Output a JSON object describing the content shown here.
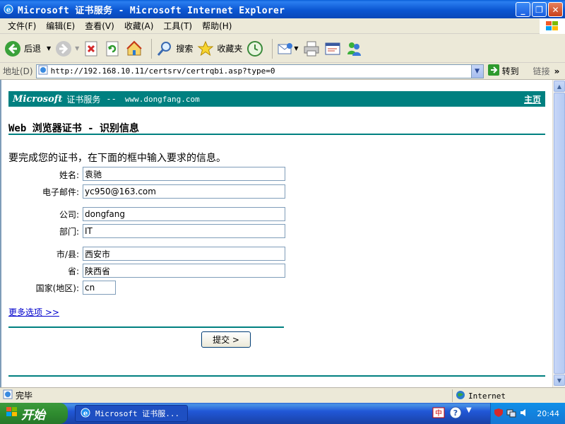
{
  "window": {
    "title": "Microsoft 证书服务 - Microsoft Internet Explorer"
  },
  "menu": [
    "文件(F)",
    "编辑(E)",
    "查看(V)",
    "收藏(A)",
    "工具(T)",
    "帮助(H)"
  ],
  "toolbar": {
    "back_label": "后退",
    "search_label": "搜索",
    "favorites_label": "收藏夹"
  },
  "address": {
    "label": "地址(D)",
    "url": "http://192.168.10.11/certsrv/certrqbi.asp?type=0",
    "go_label": "转到",
    "links_label": "链接"
  },
  "page": {
    "banner_ms": "Microsoft",
    "banner_service": "证书服务",
    "banner_dash": "--",
    "banner_site": "www.dongfang.com",
    "home_link": "主页",
    "title": "Web 浏览器证书 - 识别信息",
    "instructions": "要完成您的证书，在下面的框中输入要求的信息。",
    "fields": {
      "name_label": "姓名:",
      "name_value": "袁驰",
      "email_label": "电子邮件:",
      "email_value": "yc950@163.com",
      "company_label": "公司:",
      "company_value": "dongfang",
      "dept_label": "部门:",
      "dept_value": "IT",
      "city_label": "市/县:",
      "city_value": "西安市",
      "province_label": "省:",
      "province_value": "陕西省",
      "country_label": "国家(地区):",
      "country_value": "cn"
    },
    "more_options": "更多选项 >>",
    "submit_label": "提交 >"
  },
  "status": {
    "text": "完毕",
    "zone": "Internet"
  },
  "taskbar": {
    "start_label": "开始",
    "task_label": "Microsoft 证书服...",
    "clock": "20:44"
  },
  "colors": {
    "teal": "#008080",
    "xp_blue": "#0a5fd8"
  }
}
